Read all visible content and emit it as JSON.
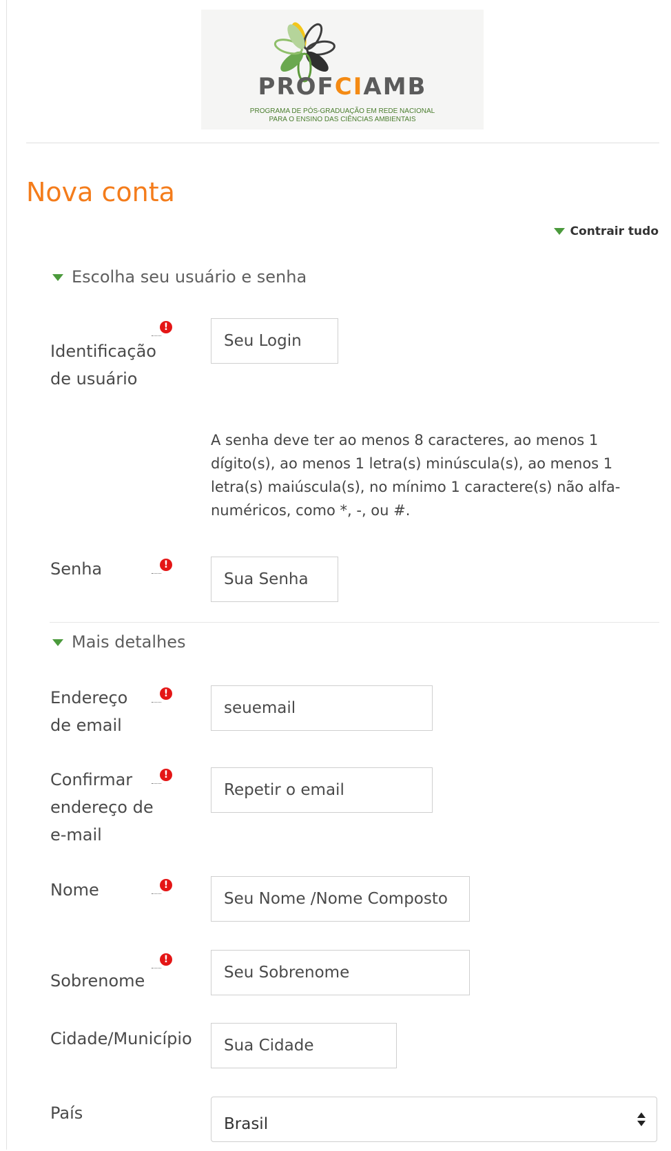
{
  "logo": {
    "brand_left": "PROF",
    "brand_mid": "CI",
    "brand_right": "AMB",
    "tagline_1": "PROGRAMA DE PÓS-GRADUAÇÃO EM REDE NACIONAL",
    "tagline_2": "PARA O ENSINO DAS CIÊNCIAS AMBIENTAIS"
  },
  "page": {
    "title": "Nova conta",
    "collapse_all": "Contrair tudo"
  },
  "sections": {
    "credentials": "Escolha seu usuário e senha",
    "details": "Mais detalhes"
  },
  "fields": {
    "username": {
      "label_1": "Identificação",
      "label_2": "de usuário",
      "value": "Seu Login"
    },
    "password_rule": "A senha deve ter ao menos 8 caracteres, ao menos 1 dígito(s), ao menos 1 letra(s) minúscula(s), ao menos 1 letra(s) maiúscula(s), no mínimo 1 caractere(s) não alfa-numéricos, como *, -, ou #.",
    "password": {
      "label": "Senha",
      "value": "Sua Senha"
    },
    "email": {
      "label_1": "Endereço",
      "label_2": "de email",
      "value": "seuemail"
    },
    "email_confirm": {
      "label_1": "Confirmar",
      "label_2": "endereço de",
      "label_3": "e-mail",
      "value": "Repetir o email"
    },
    "first_name": {
      "label": "Nome",
      "value": "Seu Nome /Nome Composto"
    },
    "last_name": {
      "label": "Sobrenome",
      "value": "Seu Sobrenome"
    },
    "city": {
      "label": "Cidade/Município",
      "value": "Sua Cidade"
    },
    "country": {
      "label": "País",
      "value": "Brasil"
    }
  },
  "icons": {
    "required": "exclamation-circle-icon",
    "collapse": "triangle-down-icon"
  },
  "colors": {
    "title": "#f47c1b",
    "accent_green": "#4b9a3c",
    "required_red": "#e41616"
  }
}
